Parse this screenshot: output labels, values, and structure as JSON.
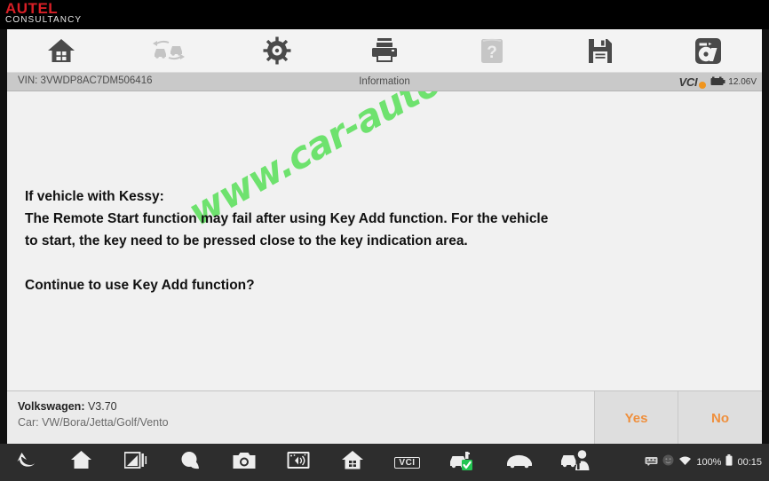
{
  "brand": {
    "name": "AUTEL",
    "subtitle": "CONSULTANCY",
    "color_primary": "#d81f26"
  },
  "toolbar": {
    "items": [
      {
        "icon": "home-icon",
        "name": "home"
      },
      {
        "icon": "vehicle-swap-icon",
        "name": "vehicle-swap"
      },
      {
        "icon": "gear-icon",
        "name": "settings"
      },
      {
        "icon": "printer-icon",
        "name": "print"
      },
      {
        "icon": "help-book-icon",
        "name": "help",
        "disabled": true
      },
      {
        "icon": "save-disk-icon",
        "name": "save"
      },
      {
        "icon": "data-logging-icon",
        "name": "data-logging"
      }
    ]
  },
  "status_bar": {
    "vin_label": "VIN: 3VWDP8AC7DM506416",
    "title": "Information",
    "vci_label": "VCI",
    "vci_state_color": "#f0951e",
    "battery_voltage": "12.06V"
  },
  "content": {
    "message_lines": [
      "If vehicle with Kessy:",
      "The Remote Start function may fail after using Key Add function. For the vehicle",
      "to start, the key need to be pressed close to the key indication area.",
      "",
      "Continue to use Key Add function?"
    ],
    "watermark": "www.car-auto-repair.com",
    "watermark_color": "#5ce05c"
  },
  "footer": {
    "vehicle_make": "Volkswagen:",
    "software_version": "V3.70",
    "vehicle_model": "Car: VW/Bora/Jetta/Golf/Vento",
    "buttons": [
      {
        "label": "Yes",
        "name": "yes-button"
      },
      {
        "label": "No",
        "name": "no-button"
      }
    ],
    "button_text_color": "#ef8f3c"
  },
  "navbar": {
    "items": [
      {
        "icon": "back-arrow-icon",
        "name": "back"
      },
      {
        "icon": "home-icon",
        "name": "home"
      },
      {
        "icon": "display-icon",
        "name": "display"
      },
      {
        "icon": "browser-icon",
        "name": "browser"
      },
      {
        "icon": "camera-icon",
        "name": "camera"
      },
      {
        "icon": "screenshot-icon",
        "name": "screen-recorder"
      },
      {
        "icon": "app-home-icon",
        "name": "app-home"
      },
      {
        "icon": "vci-chip-icon",
        "name": "vci-manager",
        "label": "VCI"
      },
      {
        "icon": "vehicle-connected-icon",
        "name": "vehicle-connected"
      },
      {
        "icon": "vehicle-icon",
        "name": "vehicle"
      },
      {
        "icon": "service-icon",
        "name": "service"
      }
    ],
    "status": {
      "keyboard_icon": "keyboard-icon",
      "face_icon": "user-circle-icon",
      "wifi_icon": "wifi-icon",
      "battery_percent": "100%",
      "battery_icon": "battery-icon",
      "clock": "00:15"
    }
  }
}
